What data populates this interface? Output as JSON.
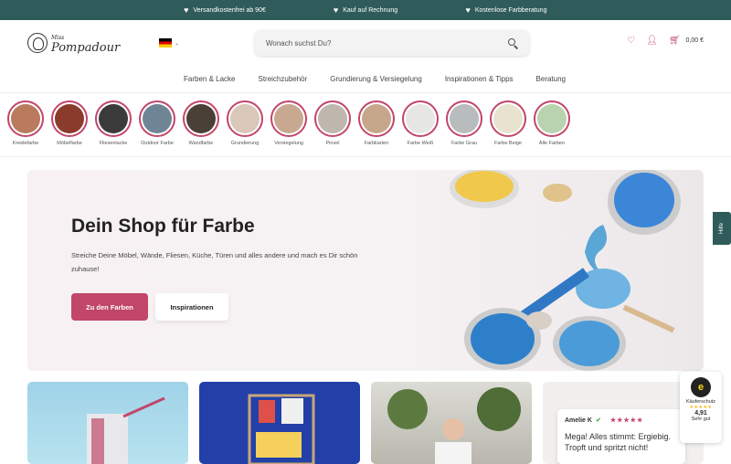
{
  "topbar": {
    "usps": [
      "Versandkostenfrei ab 90€",
      "Kauf auf Rechnung",
      "Kostenlose Farbberatung"
    ]
  },
  "header": {
    "logo_small": "Miss",
    "logo_text": "Pompadour",
    "search_placeholder": "Wonach suchst Du?",
    "cart_amount": "0,00 €"
  },
  "nav": {
    "items": [
      "Farben & Lacke",
      "Streichzubehör",
      "Grundierung & Versiegelung",
      "Inspirationen & Tipps",
      "Beratung"
    ]
  },
  "categories": [
    {
      "label": "Kreidefarbe",
      "color": "#b97a5e"
    },
    {
      "label": "Möbelfarbe",
      "color": "#8a3b2c"
    },
    {
      "label": "Fliesenlacke",
      "color": "#3b3b3b"
    },
    {
      "label": "Outdoor Farbe",
      "color": "#6f8595"
    },
    {
      "label": "Wandfarbe",
      "color": "#4a4038"
    },
    {
      "label": "Grundierung",
      "color": "#d9c8b8"
    },
    {
      "label": "Versiegelung",
      "color": "#c8a890"
    },
    {
      "label": "Pinsel",
      "color": "#bdb7ad"
    },
    {
      "label": "Farbkarten",
      "color": "#c7a78b"
    },
    {
      "label": "Farbe Weiß",
      "color": "#e6e6e4"
    },
    {
      "label": "Farbe Grau",
      "color": "#b8bcbc"
    },
    {
      "label": "Farbe Beige",
      "color": "#e8e3cf"
    },
    {
      "label": "Alle Farben",
      "color": "#b9d3b0"
    }
  ],
  "hero": {
    "title": "Dein Shop für Farbe",
    "text": "Streiche Deine Möbel, Wände, Fliesen, Küche, Türen und alles andere und mach es Dir schön zuhause!",
    "primary_button": "Zu den Farben",
    "secondary_button": "Inspirationen"
  },
  "help_tab": "Hilfe",
  "review": {
    "name": "Amelie K",
    "stars": "★★★★★",
    "text": "Mega! Alles stimmt: Ergiebig. Tropft und spritzt nicht!"
  },
  "trusted_shops": {
    "label": "Käuferschutz",
    "stars": "★★★★★",
    "score": "4,91",
    "rating": "Sehr gut"
  },
  "colors": {
    "brand_teal": "#2f5c5a",
    "accent_pink": "#c2466a"
  }
}
